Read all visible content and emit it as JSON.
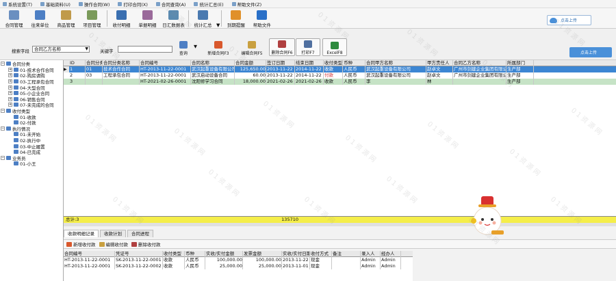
{
  "menu": [
    {
      "label": "系统设置(T)",
      "icon": "settings-icon"
    },
    {
      "label": "基础资料(U)",
      "icon": "data-icon"
    },
    {
      "label": "操作合同(W)",
      "icon": "contract-icon"
    },
    {
      "label": "打印合同(X)",
      "icon": "print-icon"
    },
    {
      "label": "合同查询(A)",
      "icon": "query-icon"
    },
    {
      "label": "统计汇总(E)",
      "icon": "stats-icon"
    },
    {
      "label": "帮助文件(Z)",
      "icon": "help-icon"
    }
  ],
  "toolbar": [
    {
      "label": "合同管理",
      "color": "#6a8fc0"
    },
    {
      "label": "往来单位",
      "color": "#4d7fc4"
    },
    {
      "label": "商品管理",
      "color": "#c09a4a"
    },
    {
      "label": "项目管理",
      "color": "#7a9a5a"
    },
    {
      "label": "收付明细",
      "color": "#3a6fb0"
    },
    {
      "label": "单据明细",
      "color": "#9a6a9a"
    },
    {
      "label": "日汇数据表",
      "color": "#5a8ab0"
    },
    {
      "label": "统计汇总",
      "color": "#4a7ab0"
    },
    {
      "label": "到期提醒",
      "color": "#e0902a"
    },
    {
      "label": "帮助文件",
      "color": "#2a70c8"
    }
  ],
  "upload_top": "点击上传",
  "search": {
    "field_label": "搜索字段",
    "field_value": "合同乙方名称",
    "keyword_label": "关键字",
    "query_label": "查询",
    "buttons": [
      {
        "label": "新增合同F3",
        "color": "#d9582c"
      },
      {
        "label": "编辑合同F5",
        "color": "#c9a040"
      },
      {
        "label": "删除合同F6",
        "color": "#b04040"
      },
      {
        "label": "打印F7",
        "color": "#5070a0"
      },
      {
        "label": "ExcelF8",
        "color": "#2e8b3e"
      }
    ],
    "upload": "点击上传"
  },
  "tree": [
    {
      "level": 1,
      "box": "−",
      "label": "合同分类",
      "color": "#4d7fc4"
    },
    {
      "level": 2,
      "box": "+",
      "label": "01-技术合作合同",
      "color": "#4d7fc4"
    },
    {
      "level": 2,
      "box": "+",
      "label": "02-购房请购",
      "color": "#4d7fc4"
    },
    {
      "level": 2,
      "box": "+",
      "label": "03-工程承包合同",
      "color": "#4d7fc4"
    },
    {
      "level": 2,
      "box": "+",
      "label": "04-大型合同",
      "color": "#4d7fc4"
    },
    {
      "level": 2,
      "box": "+",
      "label": "05-小企业合同",
      "color": "#4d7fc4"
    },
    {
      "level": 2,
      "box": "+",
      "label": "06-销售合同",
      "color": "#4d7fc4"
    },
    {
      "level": 2,
      "box": "+",
      "label": "07-未完成的合同",
      "color": "#4d7fc4"
    },
    {
      "level": 1,
      "box": "−",
      "label": "收付类型",
      "color": "#4d7fc4"
    },
    {
      "level": 2,
      "box": "",
      "label": "01-收款",
      "color": "#4d7fc4"
    },
    {
      "level": 2,
      "box": "",
      "label": "02-付款",
      "color": "#4d7fc4"
    },
    {
      "level": 1,
      "box": "−",
      "label": "执行情况",
      "color": "#4d7fc4"
    },
    {
      "level": 2,
      "box": "",
      "label": "01-未开始",
      "color": "#4d7fc4"
    },
    {
      "level": 2,
      "box": "",
      "label": "02-执行中",
      "color": "#4d7fc4"
    },
    {
      "level": 2,
      "box": "",
      "label": "03-中止履置",
      "color": "#4d7fc4"
    },
    {
      "level": 2,
      "box": "",
      "label": "04-已完成",
      "color": "#4d7fc4"
    },
    {
      "level": 1,
      "box": "−",
      "label": "业务员",
      "color": "#4d7fc4"
    },
    {
      "level": 2,
      "box": "",
      "label": "01-小王",
      "color": "#4d7fc4"
    }
  ],
  "grid": {
    "columns": [
      "ID",
      "合同分类",
      "合同分类名称",
      "合同编号",
      "合同名称",
      "合同金额",
      "签订日期",
      "结束日期",
      "收付类型",
      "币种",
      "合同甲方名称",
      "甲方责任人",
      "合同乙方名称",
      "所属部门"
    ],
    "rows": [
      {
        "cells": [
          "1",
          "01",
          "技术合作合同",
          "HT-2013-11-22-0001",
          "武汉起重设备有限公司",
          "125,650.00",
          "2013-11-22",
          "2014-11-22",
          "收款",
          "人民币",
          "武汉起重设备有限公司",
          "赵卓文",
          "广州市剑建企业集团有限公司水电工程分公司",
          "生产部"
        ],
        "style": "sel"
      },
      {
        "cells": [
          "2",
          "03",
          "工程承包合同",
          "HT-2013-11-22-0001",
          "武汉启动设备合同",
          "60.00",
          "2013-11-22",
          "2014-11-22",
          "付款",
          "人民币",
          "武汉起重设备有限公司",
          "赵卓文",
          "广州市剑建企业集团有限公司水电工程分公司",
          "生产部"
        ],
        "style": ""
      },
      {
        "cells": [
          "3",
          "",
          "",
          "HT-2021-02-26-0001",
          "沈阳修学习合同",
          "18,000.00",
          "2021-02-26",
          "2021-02-26",
          "收款",
          "人民币",
          "李",
          "林",
          "",
          "生产部"
        ],
        "style": "green"
      }
    ],
    "footer_label": "总计:3",
    "footer_total": "135710"
  },
  "bottom_tabs": [
    "收款明细记录",
    "收款计划",
    "合同进程"
  ],
  "bottom_buttons": [
    {
      "label": "新增收付款",
      "color": "#d9582c"
    },
    {
      "label": "编辑收付款",
      "color": "#c9a040"
    },
    {
      "label": "删除收付款",
      "color": "#b04040"
    }
  ],
  "sub_grid": {
    "columns": [
      "合同编号",
      "凭证号",
      "收付类型",
      "币种",
      "实收/实付金额",
      "发票金额",
      "实收/实付日期",
      "收付方式",
      "备注",
      "录入人",
      "经办人"
    ],
    "rows": [
      [
        "HT-2013-11-22-0001",
        "SK-2013-11-22-0001",
        "收款",
        "人民币",
        "100,000.00",
        "100,000.00",
        "2013-11-22",
        "现金",
        "",
        "Admin",
        "Admin"
      ],
      [
        "HT-2013-11-22-0001",
        "SK-2013-11-22-0002",
        "收款",
        "人民币",
        "25,000.00",
        "25,000.00",
        "2013-11-01",
        "现金",
        "",
        "Admin",
        "Admin"
      ]
    ]
  },
  "watermark": "01资源网"
}
